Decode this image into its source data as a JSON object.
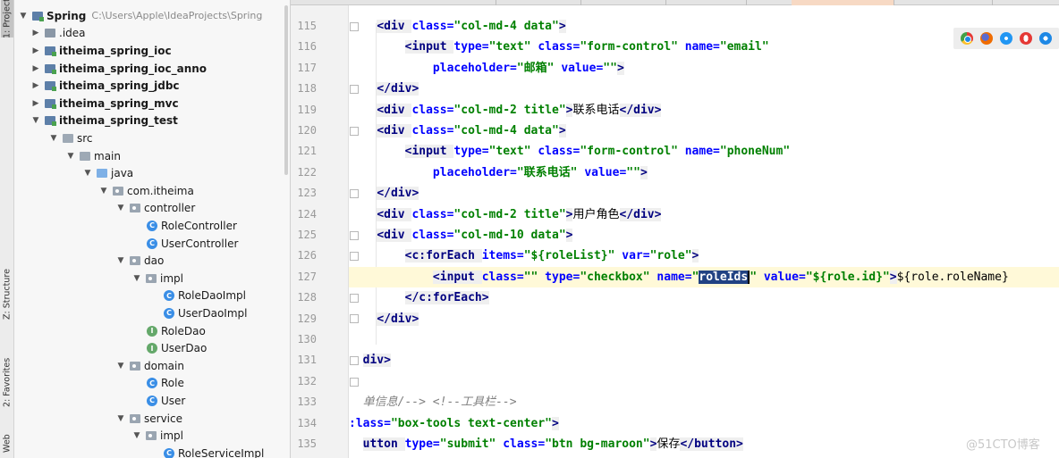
{
  "tool_strip": {
    "project_tab": "1: Project",
    "structure_tab": "Z: Structure",
    "favorites_tab": "2: Favorites",
    "web_tab": "Web"
  },
  "project_tree": {
    "root": {
      "name": "Spring",
      "path": "C:\\Users\\Apple\\IdeaProjects\\Spring"
    },
    "items": [
      {
        "label": ".idea",
        "kind": "folder",
        "bold": false
      },
      {
        "label": "itheima_spring_ioc",
        "kind": "module",
        "bold": true
      },
      {
        "label": "itheima_spring_ioc_anno",
        "kind": "module",
        "bold": true
      },
      {
        "label": "itheima_spring_jdbc",
        "kind": "module",
        "bold": true
      },
      {
        "label": "itheima_spring_mvc",
        "kind": "module",
        "bold": true
      },
      {
        "label": "itheima_spring_test",
        "kind": "module",
        "bold": true
      },
      {
        "label": "src",
        "kind": "folder",
        "bold": false
      },
      {
        "label": "main",
        "kind": "folder",
        "bold": false
      },
      {
        "label": "java",
        "kind": "source-folder",
        "bold": false
      },
      {
        "label": "com.itheima",
        "kind": "package",
        "bold": false
      },
      {
        "label": "controller",
        "kind": "package",
        "bold": false
      },
      {
        "label": "RoleController",
        "kind": "class",
        "bold": false
      },
      {
        "label": "UserController",
        "kind": "class",
        "bold": false
      },
      {
        "label": "dao",
        "kind": "package",
        "bold": false
      },
      {
        "label": "impl",
        "kind": "package",
        "bold": false
      },
      {
        "label": "RoleDaoImpl",
        "kind": "class",
        "bold": false
      },
      {
        "label": "UserDaoImpl",
        "kind": "class",
        "bold": false
      },
      {
        "label": "RoleDao",
        "kind": "interface",
        "bold": false
      },
      {
        "label": "UserDao",
        "kind": "interface",
        "bold": false
      },
      {
        "label": "domain",
        "kind": "package",
        "bold": false
      },
      {
        "label": "Role",
        "kind": "class",
        "bold": false
      },
      {
        "label": "User",
        "kind": "class",
        "bold": false
      },
      {
        "label": "service",
        "kind": "package",
        "bold": false
      },
      {
        "label": "impl",
        "kind": "package",
        "bold": false
      },
      {
        "label": "RoleServiceImpl",
        "kind": "class",
        "bold": false
      }
    ]
  },
  "editor": {
    "line_numbers": [
      "115",
      "116",
      "117",
      "118",
      "119",
      "120",
      "121",
      "122",
      "123",
      "124",
      "125",
      "126",
      "127",
      "128",
      "129",
      "130",
      "131",
      "132",
      "133",
      "134",
      "135"
    ],
    "current_line": "127",
    "selected_text": "roleIds",
    "code": {
      "l115_tag_open": "<div ",
      "l115_attr": "class=",
      "l115_val": "\"col-md-4 data\"",
      "l115_tag_close": ">",
      "l116_tag_open": "<input ",
      "l116_a1": "type=",
      "l116_v1": "\"text\"",
      "l116_a2": " class=",
      "l116_v2": "\"form-control\"",
      "l116_a3": " name=",
      "l116_v3": "\"email\"",
      "l117_a1": "placeholder=",
      "l117_v1": "\"邮箱\"",
      "l117_a2": " value=",
      "l117_v2": "\"\"",
      "l117_close": ">",
      "l118": "</div>",
      "l119_tag_open": "<div ",
      "l119_attr": "class=",
      "l119_val": "\"col-md-2 title\"",
      "l119_close": ">",
      "l119_text": "联系电话",
      "l119_end": "</div>",
      "l120_tag_open": "<div ",
      "l120_attr": "class=",
      "l120_val": "\"col-md-4 data\"",
      "l120_close": ">",
      "l121_tag_open": "<input ",
      "l121_a1": "type=",
      "l121_v1": "\"text\"",
      "l121_a2": " class=",
      "l121_v2": "\"form-control\"",
      "l121_a3": " name=",
      "l121_v3": "\"phoneNum\"",
      "l122_a1": "placeholder=",
      "l122_v1": "\"联系电话\"",
      "l122_a2": " value=",
      "l122_v2": "\"\"",
      "l122_close": ">",
      "l123": "</div>",
      "l124_tag_open": "<div ",
      "l124_attr": "class=",
      "l124_val": "\"col-md-2 title\"",
      "l124_close": ">",
      "l124_text": "用户角色",
      "l124_end": "</div>",
      "l125_tag_open": "<div ",
      "l125_attr": "class=",
      "l125_val": "\"col-md-10 data\"",
      "l125_close": ">",
      "l126_tag_open": "<c:forEach ",
      "l126_a1": "items=",
      "l126_v1": "\"${roleList}\"",
      "l126_a2": " var=",
      "l126_v2": "\"role\"",
      "l126_close": ">",
      "l127_tag_open": "<input ",
      "l127_a1": "class=",
      "l127_v1": "\"\"",
      "l127_a2": " type=",
      "l127_v2": "\"checkbox\"",
      "l127_a3": " name=",
      "l127_q1": "\"",
      "l127_q2": "\"",
      "l127_a4": " value=",
      "l127_v4": "\"${role.id}\"",
      "l127_close": ">",
      "l127_text": "${role.roleName}",
      "l128": "</c:forEach>",
      "l129": "</div>",
      "l131": "div>",
      "l133_text": "单信息/-->",
      "l133_comment": " <!--工具栏-->",
      "l134_a1": ":lass=",
      "l134_v1": "\"box-tools text-center\"",
      "l134_close": ">",
      "l135_tag": "utton ",
      "l135_a1": "type=",
      "l135_v1": "\"submit\"",
      "l135_a2": " class=",
      "l135_v2": "\"btn bg-maroon\"",
      "l135_close": ">",
      "l135_text": "保存",
      "l135_end": "</button>"
    }
  },
  "browser_icons": [
    "chrome-icon",
    "firefox-icon",
    "safari-icon",
    "opera-icon",
    "ie-icon"
  ],
  "watermark": "@51CTO博客",
  "colors": {
    "tag": "#000080",
    "attribute": "#0000ff",
    "value": "#008000",
    "selection": "#214283",
    "current_line": "#fff9d8"
  }
}
